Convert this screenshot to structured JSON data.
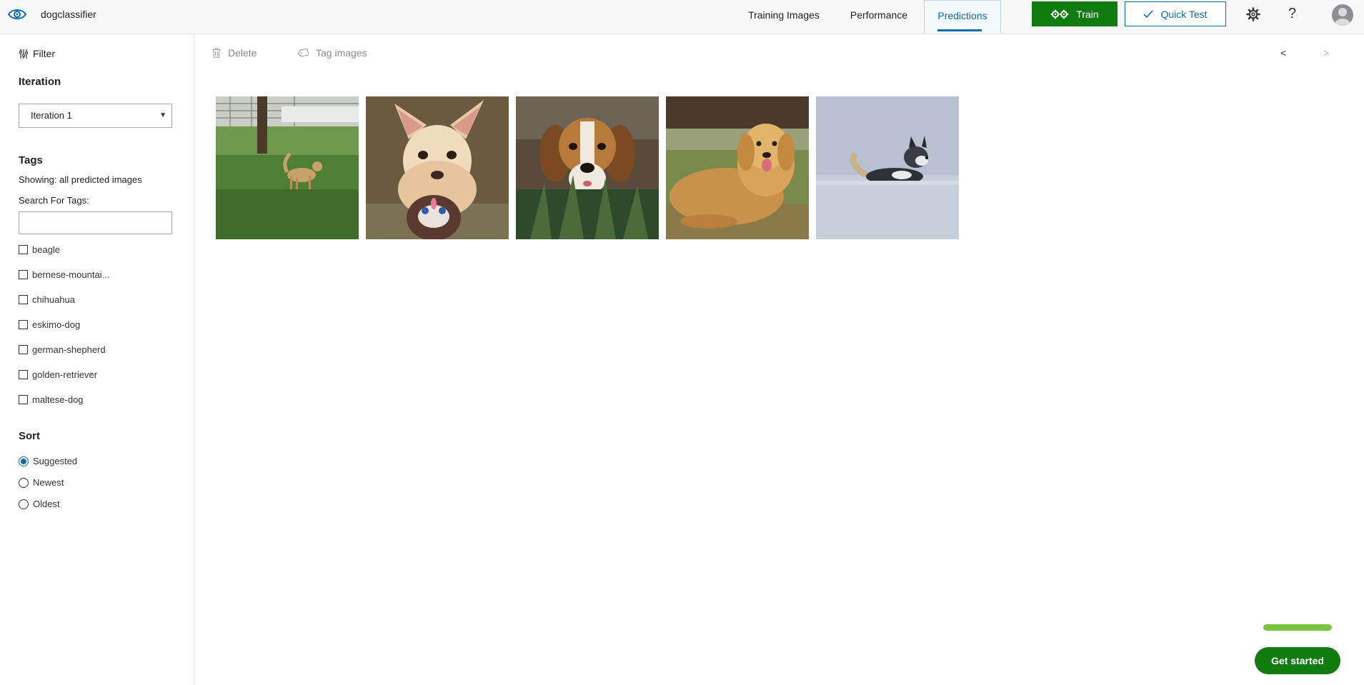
{
  "app": {
    "name": "dogclassifier"
  },
  "nav": {
    "tabs": [
      {
        "label": "Training Images",
        "active": false
      },
      {
        "label": "Performance",
        "active": false
      },
      {
        "label": "Predictions",
        "active": true
      }
    ],
    "train_label": "Train",
    "quick_test_label": "Quick Test",
    "help_glyph": "?"
  },
  "sidebar": {
    "filter_label": "Filter",
    "iteration_heading": "Iteration",
    "iteration_selected": "Iteration 1",
    "tags_heading": "Tags",
    "showing_text": "Showing: all predicted images",
    "search_label": "Search For Tags:",
    "search_value": "",
    "tags": [
      {
        "label": "beagle",
        "checked": false
      },
      {
        "label": "bernese-mountai...",
        "checked": false
      },
      {
        "label": "chihuahua",
        "checked": false
      },
      {
        "label": "eskimo-dog",
        "checked": false
      },
      {
        "label": "german-shepherd",
        "checked": false
      },
      {
        "label": "golden-retriever",
        "checked": false
      },
      {
        "label": "maltese-dog",
        "checked": false
      }
    ],
    "sort_heading": "Sort",
    "sort_options": [
      {
        "label": "Suggested",
        "checked": true
      },
      {
        "label": "Newest",
        "checked": false
      },
      {
        "label": "Oldest",
        "checked": false
      }
    ]
  },
  "toolbar": {
    "delete_label": "Delete",
    "tag_images_label": "Tag images",
    "prev_glyph": "<",
    "next_glyph": ">"
  },
  "images": [
    {
      "icon": "dog-in-park-photo"
    },
    {
      "icon": "chihuahua-photo"
    },
    {
      "icon": "beagle-photo"
    },
    {
      "icon": "golden-retriever-photo"
    },
    {
      "icon": "husky-in-snow-photo"
    }
  ],
  "get_started": {
    "label": "Get started",
    "progress": 1.0
  },
  "colors": {
    "accent": "#0e6bab",
    "primary_green": "#107c10",
    "progress_green": "#7cc242"
  }
}
